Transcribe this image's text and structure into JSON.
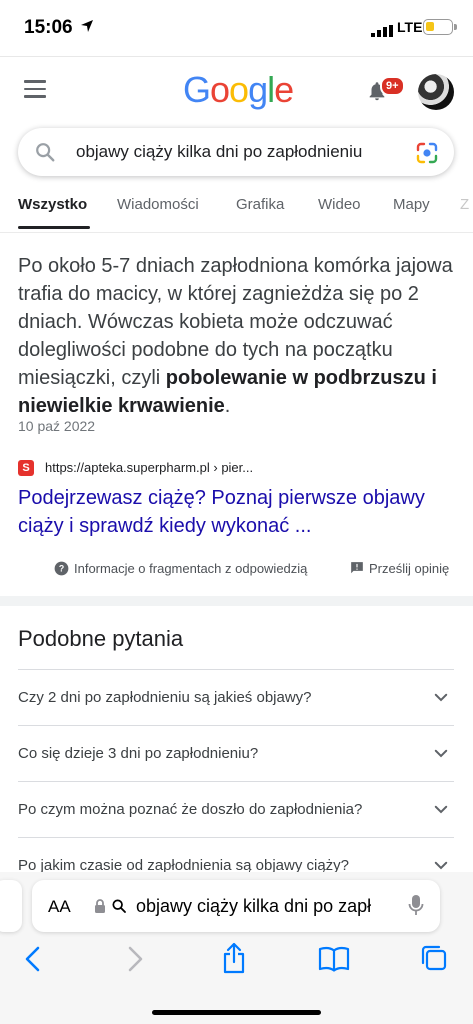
{
  "status_bar": {
    "time": "15:06",
    "network": "LTE"
  },
  "header": {
    "logo_letters": [
      {
        "ch": "G",
        "color": "#4285F4"
      },
      {
        "ch": "o",
        "color": "#EA4335"
      },
      {
        "ch": "o",
        "color": "#FBBC05"
      },
      {
        "ch": "g",
        "color": "#4285F4"
      },
      {
        "ch": "l",
        "color": "#34A853"
      },
      {
        "ch": "e",
        "color": "#EA4335"
      }
    ],
    "notification_badge": "9+"
  },
  "search": {
    "query": "objawy ciąży kilka dni po zapłodnieniu"
  },
  "tabs": [
    "Wszystko",
    "Wiadomości",
    "Grafika",
    "Wideo",
    "Mapy",
    "Z"
  ],
  "snippet": {
    "text_plain": "Po około 5-7 dniach zapłodniona komórka jajowa trafia do macicy, w której zagnieżdża się po 2 dniach. Wówczas kobieta może odczuwać dolegliwości podobne do tych na początku miesiączki, czyli ",
    "text_bold": "pobolewanie w podbrzuszu i niewielkie krwawienie",
    "text_end": ".",
    "date": "10 paź 2022",
    "url": "https://apteka.superpharm.pl › pier...",
    "title": "Podejrzewasz ciążę? Poznaj pierwsze objawy ciąży i sprawdź kiedy wykonać ...",
    "about_label": "Informacje o fragmentach z odpowiedzią",
    "feedback_label": "Prześlij opinię"
  },
  "paa": {
    "title": "Podobne pytania",
    "questions": [
      "Czy 2 dni po zapłodnieniu są jakieś objawy?",
      "Co się dzieje 3 dni po zapłodnieniu?",
      "Po czym można poznać że doszło do zapłodnienia?",
      "Po jakim czasie od zapłodnienia są objawy ciąży?"
    ]
  },
  "safari": {
    "aa_label": "AA",
    "address_text": "objawy ciąży kilka dni po zapł"
  }
}
